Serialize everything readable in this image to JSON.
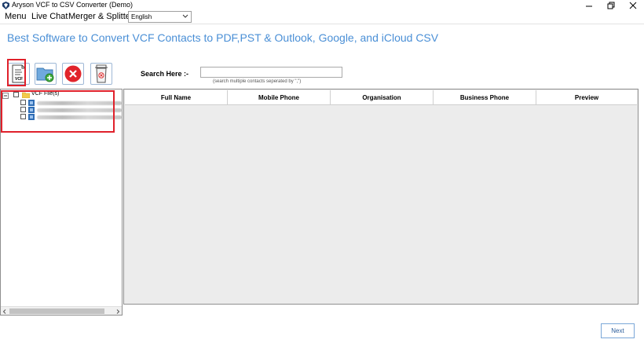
{
  "window": {
    "title": "Aryson VCF to CSV Converter (Demo)"
  },
  "menubar": {
    "items": [
      "Menu",
      "Live Chat",
      "Merger & Splitter"
    ],
    "language": "English"
  },
  "headline": "Best Software to Convert VCF Contacts to PDF,PST & Outlook, Google, and iCloud CSV",
  "toolbar": {
    "buttons": [
      {
        "icon": "vcf-file-icon",
        "label": "VCF"
      },
      {
        "icon": "add-folder-icon"
      },
      {
        "icon": "remove-icon"
      },
      {
        "icon": "delete-bin-icon"
      }
    ],
    "highlight_color": "#e0212b"
  },
  "search": {
    "label": "Search Here :-",
    "value": "",
    "hint": "(search multiple contacts seperated by \",\")"
  },
  "tree": {
    "root_label": "VCF File(s)",
    "children_count": 3
  },
  "grid": {
    "columns": [
      "Full Name",
      "Mobile Phone",
      "Organisation",
      "Business Phone",
      "Preview"
    ],
    "rows": []
  },
  "footer": {
    "next_label": "Next"
  },
  "colors": {
    "accent": "#4a8fd6",
    "highlight": "#e0212b"
  }
}
